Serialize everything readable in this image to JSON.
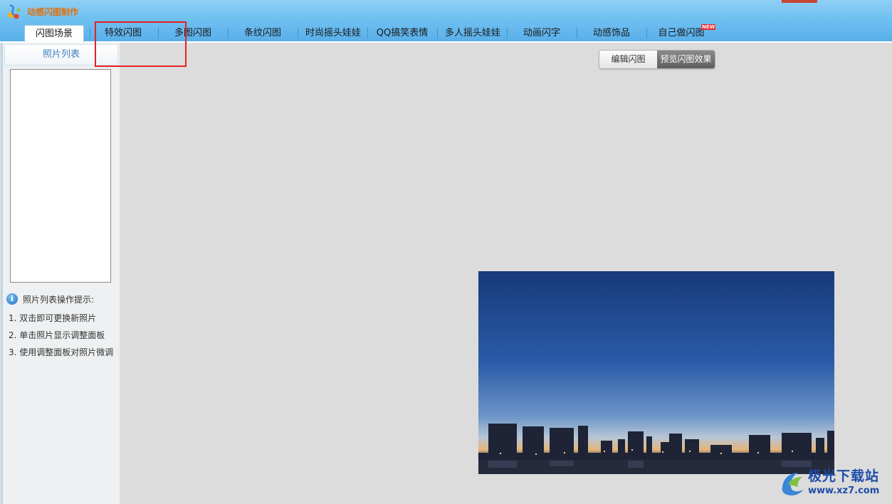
{
  "app": {
    "title": "动感闪图制作"
  },
  "tabs": [
    {
      "label": "闪图场景",
      "active": true
    },
    {
      "label": "特效闪图",
      "active": false
    },
    {
      "label": "多图闪图",
      "active": false
    },
    {
      "label": "条纹闪图",
      "active": false
    },
    {
      "label": "时尚摇头娃娃",
      "active": false
    },
    {
      "label": "QQ搞笑表情",
      "active": false
    },
    {
      "label": "多人摇头娃娃",
      "active": false
    },
    {
      "label": "动画闪字",
      "active": false
    },
    {
      "label": "动感饰品",
      "active": false
    },
    {
      "label": "自己做闪图",
      "active": false
    }
  ],
  "new_badge": "NEW",
  "sidebar": {
    "header": "照片列表",
    "tips_title": "照片列表操作提示:",
    "tips": [
      "1. 双击即可更换新照片",
      "2. 单击照片显示调整面板",
      "3. 使用调整面板对照片微调"
    ]
  },
  "mode": {
    "edit_label": "编辑闪图",
    "preview_label": "预览闪图效果",
    "selected": "preview"
  },
  "watermark": {
    "title": "极光下载站",
    "url": "www.xz7.com"
  },
  "colors": {
    "accent": "#68bdef",
    "highlight": "#e32222",
    "title_orange": "#e0700c"
  }
}
